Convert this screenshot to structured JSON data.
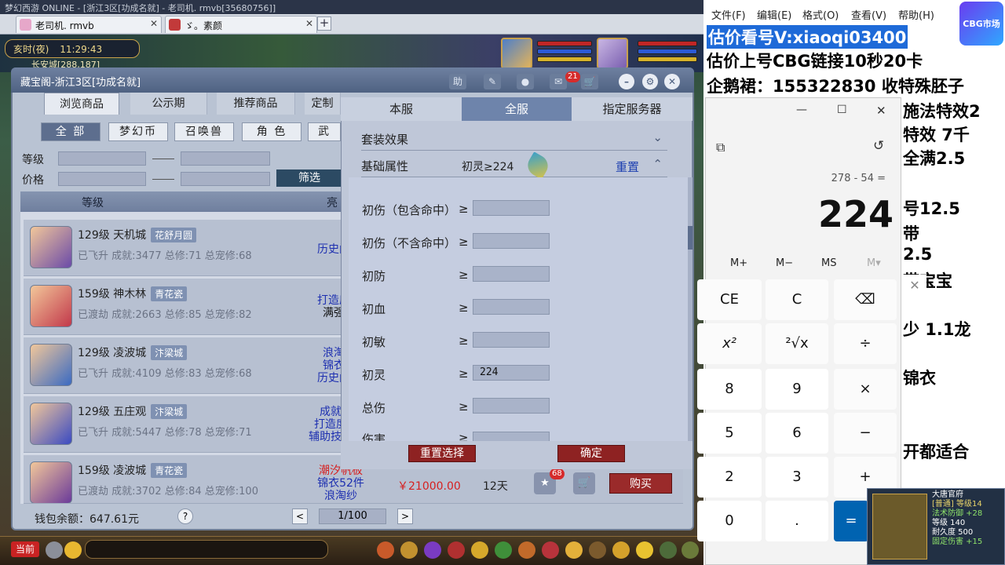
{
  "top": {
    "text": "梦幻西游 ONLINE - [浙江3区[功成名就] - 老司机. rmvb[35680756]]"
  },
  "tabs": [
    {
      "label": "老司机. rmvb"
    },
    {
      "label": "ゞ。素颜"
    }
  ],
  "newtab": "+",
  "hud": {
    "time_label": "亥时(夜)",
    "clock": "11:29:43",
    "place": "长安城[288,187]"
  },
  "bottom": {
    "mode": "当前"
  },
  "panel": {
    "title": "藏宝阁-浙江3区[功成名就]",
    "help": "助",
    "cart_count": "21",
    "main_tabs": [
      "浏览商品",
      "公示期",
      "推荐商品",
      "定制"
    ],
    "cat_tabs": [
      "全 部",
      "梦幻币",
      "召唤兽",
      "角 色",
      "武"
    ],
    "level_label": "等级",
    "price_label": "价格",
    "filter_btn": "筛选",
    "col_level": "等级",
    "col_highlight": "亮"
  },
  "rows": [
    {
      "line1": "129级  天机城",
      "badge": "花舒月圆",
      "line2": "已飞升  成就:3477  总修:71  总宠修:68",
      "desc": [
        "历史门"
      ],
      "price": "",
      "days": ""
    },
    {
      "line1": "159级  神木林",
      "badge": "青花瓷",
      "line2": "已渡劫  成就:2663  总修:85  总宠修:82",
      "desc": [
        "打造度",
        "满强"
      ],
      "price": "",
      "days": ""
    },
    {
      "line1": "129级  凌波城",
      "badge": "汴梁城",
      "line2": "已飞升  成就:4109  总修:83  总宠修:68",
      "desc": [
        "浪淘",
        "锦衣",
        "历史门"
      ],
      "price": "",
      "days": ""
    },
    {
      "line1": "129级  五庄观",
      "badge": "汴梁城",
      "line2": "已飞升  成就:5447  总修:78  总宠修:71",
      "desc": [
        "成就",
        "打造度",
        "辅助技能"
      ],
      "price": "",
      "days": ""
    },
    {
      "line1": "159级  凌波城",
      "badge": "青花瓷",
      "line2": "已渡劫  成就:3702  总修:84  总宠修:100",
      "desc": [
        "潮汐帆板",
        "锦衣52件",
        "浪淘纱"
      ],
      "price": "￥21000.00",
      "days": "12天",
      "fav_count": "68",
      "buy": "购买"
    }
  ],
  "footer": {
    "wallet": "钱包余额：647.61元",
    "help": "?",
    "page": "1/100",
    "prev": "<",
    "next": ">"
  },
  "popup": {
    "tabs": [
      "本服",
      "全服",
      "指定服务器"
    ],
    "set_effect": "套装效果",
    "base_attr": "基础属性",
    "base_summary": "初灵≥224",
    "reset": "重置",
    "ge": "≥",
    "attrs": [
      {
        "label": "初伤（包含命中）",
        "value": ""
      },
      {
        "label": "初伤（不含命中）",
        "value": ""
      },
      {
        "label": "初防",
        "value": ""
      },
      {
        "label": "初血",
        "value": ""
      },
      {
        "label": "初敏",
        "value": ""
      },
      {
        "label": "初灵",
        "value": "224"
      },
      {
        "label": "总伤",
        "value": ""
      },
      {
        "label": "伤害",
        "value": ""
      }
    ],
    "reset_sel": "重置选择",
    "confirm": "确定"
  },
  "notepad": {
    "menu": [
      "文件(F)",
      "编辑(E)",
      "格式(O)",
      "查看(V)",
      "帮助(H)"
    ]
  },
  "overlay": [
    "估价看号V:xiaoqi03400",
    "估价上号CBG链接10秒20卡",
    "企鹅裙：155322830 收特殊胚子",
    "施法特效2",
    "特效 7千",
    "全满2.5",
    "号12.5",
    "带",
    "2.5",
    "带宝宝",
    "少 1.1龙",
    "锦衣",
    "开都适合"
  ],
  "calc": {
    "expr": "278 - 54 =",
    "result": "224",
    "mem": [
      "M+",
      "M−",
      "MS",
      "M▾"
    ],
    "keys": [
      "CE",
      "C",
      "⌫",
      "x²",
      "²√x",
      "÷",
      "8",
      "9",
      "×",
      "5",
      "6",
      "−",
      "2",
      "3",
      "+",
      "0",
      ".",
      "="
    ]
  },
  "sticker": "CBG市场",
  "mini_text": [
    "大唐官府",
    "[普通] 等级14",
    "法术防御 +28",
    "等级 140",
    "耐久度 500",
    "固定伤害 +15"
  ]
}
